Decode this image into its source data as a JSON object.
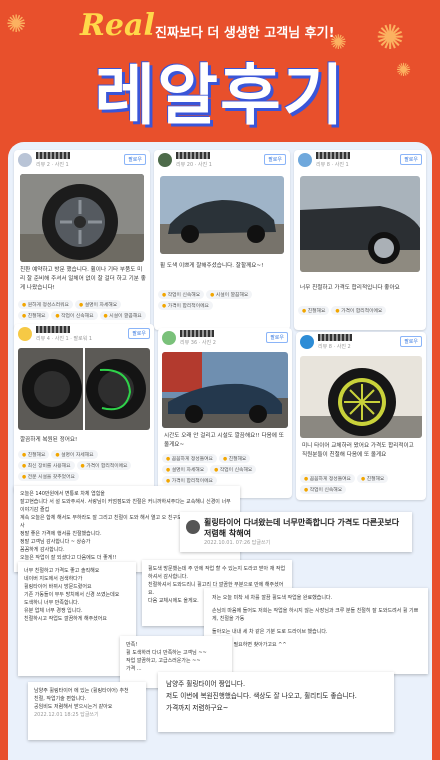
{
  "header": {
    "real": "Real",
    "tagline": "진짜보다 더 생생한 고객님 후기!",
    "title": "레알후기"
  },
  "follow_label": "팔로우",
  "cards": {
    "c1": {
      "meta": "리뷰 2 · 사진 1",
      "text": "친환 예약하고 방문 했습니다. 휠이나 기타 부품도 미리 잘 준비해 주셔서 일체어 없이 잘 걸더 하고 기분 좋게 나왔습니다!",
      "tags": [
        "원하게 정성스러워요",
        "설명이 자세해요",
        "친절해요",
        "작업이 신속해요",
        "시설이 깔끔해요"
      ]
    },
    "c2": {
      "meta": "리뷰 20 · 사진 1",
      "text": "휠 도색 이쁘게 잘해주셨습니다. 잘할께요~!",
      "tags": [
        "작업이 신속해요",
        "시설이 깔끔해요",
        "가격이 합리적이에요"
      ]
    },
    "c3": {
      "meta": "리뷰 8 · 사진 1",
      "text": "너무 친절하고 가격도 합리적입니다 좋아요",
      "tags": [
        "친절해요",
        "가격이 합리적이에요"
      ]
    },
    "c4": {
      "meta": "리뷰 4 · 사진 1 · 팔로워 1",
      "text": "깔끔하게 복원된 정어요!",
      "tags": [
        "친절해요",
        "설명이 자세해요",
        "최신 장비를 사용해요",
        "가격이 합리적이에요",
        "전문 시설을 갖추었어요"
      ]
    },
    "c5": {
      "meta": "리뷰 36 · 사진 2",
      "text": "시간도 오래 안 걸리고 시설도 깔끔해요!! 다음에 또 올게요~",
      "tags": [
        "꼼꼼하게 정성들여요",
        "친절해요",
        "설명이 자세해요",
        "작업이 신속해요",
        "가격이 합리적이에요"
      ]
    },
    "c6": {
      "meta": "리뷰 8 · 사진 2",
      "text": "미니 타이어 교체하러 왔어요 가격도 합리적이고 직원분들이 친절해 다음에 또 올게요",
      "tags": [
        "꼼꼼하게 정성들여요",
        "친절해요",
        "작업이 신속해요"
      ]
    }
  },
  "notes": {
    "n1": {
      "lines": [
        "오늘은 140만원에서 변통로 차체 엽힘을",
        "잘고현습니다 서 설 도와주셔서. 서랑님이 커엄점도와 친절은 커니까하셔주다는 교속해니 신경이 너무 이야기감 즐겁",
        "계속 오늘은 합체 해서도 무하라도 잘 그리고 친절이 도와 해서 열고 오 친구도를 부끄러운거 나도를 감사",
        "정말 좋은 가격에 행서를 친절했습니다.",
        "정말 고객님 감사합니다 ~ 상승가",
        "꼼꼼하게 감사합니다.",
        "오늘은 작업이 잘 되셨다고 다음에도 더 좋게!!"
      ]
    },
    "n2": {
      "text": "휠링타이어 다녀왔는데 너무만족합니다 가격도 다른곳보다저렴해 착해여",
      "date": "2022.10.01. 07:26 답글쓰기"
    },
    "n3": {
      "lines": [
        "너무 친절하고 가격도 좋고 솔직해요",
        "네이버 지도에서 검색하다가",
        "휠링타이어 바뀌시 방문드렸어요",
        "기존 가동들이 무두 방치에서 신경 쓰였는데요",
        "도색하니 너무 만족합니다.",
        "유분 업체 너무 경쟁 입니다.",
        "친절하시고 작업도 깔끔하게 해주셨어요"
      ]
    },
    "n4": {
      "lines": [
        "휠도색 방문했는데 주 안에 작업 할 수 있는지 도라코 받아 재 작업하셔서 감사합니다.",
        "친절하셔서 도와드리니 휠고리 다 깔끔한 무분으로 만에 해주셨어요.",
        "다음 교체시에도 올게요."
      ]
    },
    "n5": {
      "lines": [
        "저는 오늘 미착 세 차를 깔끔 휠도색 작업을 완료했습니다.",
        "손님의 마음에 들어도 저희는 작업을 하시지 않는 사장님과 크루 분들 친절히 잘 도와드려서 휠 기쁘게, 친절을 가동",
        "돌아오는 내내 세 차 같은 기분 도로 드라이브 했습니다.",
        "다음에 또 필요하면 찾아가고요 ^^"
      ]
    },
    "n6": {
      "lines": [
        "만족!",
        "휠 도색하러 다녀 만족하는 고객님 ~~",
        "작업 깔끔하고, 고급스러운가는 ~~",
        "가격 ..."
      ]
    },
    "n7": {
      "lines": [
        "남양주 휠링타이어 에 있는 (휠링타이어) 추천",
        "친절, 작업기술 편합니다.",
        "공임비도 저렴해서 받으시는거 같아요"
      ],
      "date": "2022.12.01 18:25 답글쓰기"
    },
    "n8": {
      "lines": [
        "남양주 휠링타이어 짱입니다.",
        "저도 이번에 복원진행했습니다. 색상도 잘 나오고, 휠리티도 좋습니다.",
        "가격까지 저렴하구요~"
      ]
    }
  }
}
